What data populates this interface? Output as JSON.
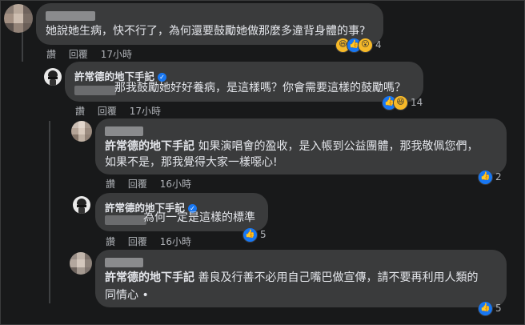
{
  "author": {
    "name": "許常德的地下手記"
  },
  "actions": {
    "like": "讚",
    "reply": "回覆"
  },
  "comments": [
    {
      "text": "她說她生病，快不行了，為何還要鼓勵她做那麼多違背身體的事?",
      "time": "17小時",
      "reactions": [
        "haha-icon",
        "like-icon",
        "wow-icon"
      ],
      "count": "4"
    },
    {
      "text": "那我鼓勵她好好養病，是這樣嗎？你會需要這樣的鼓勵嗎？",
      "time": "17小時",
      "reactions": [
        "like-icon",
        "haha-icon"
      ],
      "count": "14"
    },
    {
      "text_line1": "如果演唱會的盈收，是入帳到公益團體，那我敬佩您們，",
      "text_line2": "如果不是，那我覺得大家一樣噁心!",
      "time": "16小時",
      "reactions": [
        "like-icon"
      ],
      "count": "2"
    },
    {
      "text": "為何一定是這樣的標準",
      "time": "16小時",
      "reactions": [
        "like-icon"
      ],
      "count": "5"
    },
    {
      "text_line1": "善良及行善不必用自己嘴巴做宣傳，請不要再利用人類的",
      "text_line2": "同情心 •",
      "time": "16小時",
      "reactions": [
        "like-icon"
      ],
      "count": "5"
    }
  ],
  "colors": {
    "bubble": "#3a3b3c",
    "background": "#18191a",
    "like": "#1877f2",
    "haha": "#f7b928"
  }
}
